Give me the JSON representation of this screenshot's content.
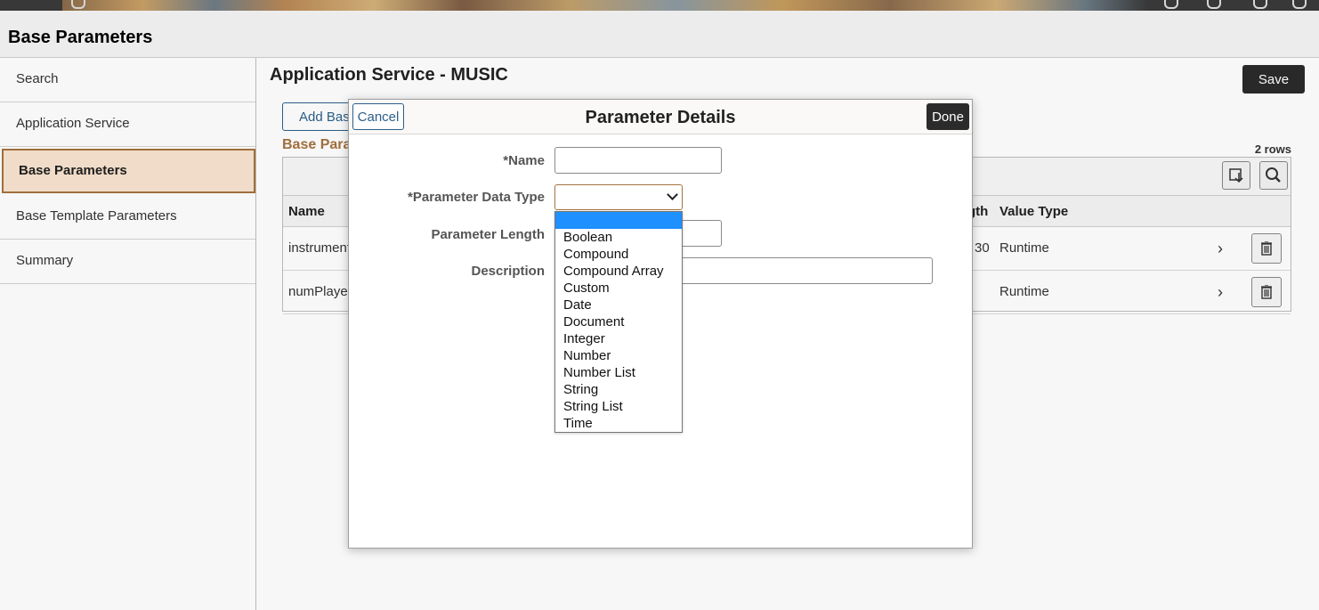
{
  "header": {
    "title": "Base Parameters"
  },
  "sidebar": {
    "items": [
      {
        "label": "Search"
      },
      {
        "label": "Application Service"
      },
      {
        "label": "Base Parameters"
      },
      {
        "label": "Base Template Parameters"
      },
      {
        "label": "Summary"
      }
    ],
    "active_index": 2
  },
  "main": {
    "title": "Application Service - MUSIC",
    "save_label": "Save",
    "add_label": "Add Bas",
    "grid_title": "Base Para",
    "rows_count": "2 rows",
    "columns": {
      "name": "Name",
      "length_partial": "gth",
      "value_type": "Value Type"
    },
    "rows": [
      {
        "name": "instrument",
        "length": "30",
        "value_type": "Runtime"
      },
      {
        "name": "numPlayer",
        "length": "",
        "value_type": "Runtime"
      }
    ]
  },
  "modal": {
    "title": "Parameter Details",
    "cancel_label": "Cancel",
    "done_label": "Done",
    "fields": {
      "name_label": "*Name",
      "name_value": "",
      "data_type_label": "*Parameter Data Type",
      "data_type_value": "",
      "length_label": "Parameter Length",
      "length_value": "",
      "description_label": "Description",
      "description_value": ""
    },
    "data_type_options": [
      "",
      "Boolean",
      "Compound",
      "Compound Array",
      "Custom",
      "Date",
      "Document",
      "Integer",
      "Number",
      "Number List",
      "String",
      "String List",
      "Time"
    ],
    "highlighted_index": 0
  },
  "colors": {
    "accent": "#a5723e",
    "active_bg": "#f8e4cf",
    "link": "#2d5f8a",
    "dark_button": "#2b2b2b",
    "option_highlight": "#1e90ff"
  }
}
